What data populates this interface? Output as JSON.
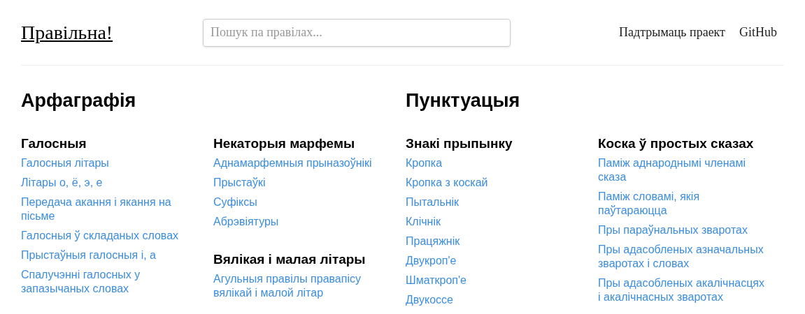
{
  "header": {
    "logo": "Правільна!",
    "search": {
      "placeholder": "Пошук па правілах..."
    },
    "nav": [
      "Падтрымаць праект",
      "GitHub"
    ]
  },
  "sections": [
    {
      "title": "Арфаграфія",
      "columns": [
        [
          {
            "heading": "Галосныя",
            "links": [
              "Галосныя літары",
              "Літары о, ё, э, е",
              "Передача акання і якання на пісьме",
              "Галосныя ў складаных словах",
              "Прыстаўныя галосныя і, а",
              "Спалучэнні галосных у запазычаных словах"
            ]
          }
        ],
        [
          {
            "heading": "Некаторыя марфемы",
            "links": [
              "Аднамарфемныя прыназоўнікі",
              "Прыстаўкі",
              "Суфіксы",
              "Абрэвіятуры"
            ]
          },
          {
            "heading": "Вялікая і малая літары",
            "links": [
              "Агульныя правілы правапісу вялікай і малой літар"
            ]
          }
        ]
      ]
    },
    {
      "title": "Пунктуацыя",
      "columns": [
        [
          {
            "heading": "Знакі прыпынку",
            "links": [
              "Кропка",
              "Кропка з коскай",
              "Пытальнік",
              "Клічнік",
              "Працяжнік",
              "Двукроп'е",
              "Шматкроп'е",
              "Двукоссе"
            ]
          }
        ],
        [
          {
            "heading": "Коска ў простых сказах",
            "links": [
              "Паміж аднароднымі членамі сказа",
              "Паміж словамі, якія паўтараюцца",
              "Пры параўнальных зваротах",
              "Пры адасобленых азначальных зваротах і словах",
              "Пры адасобленых акалічнасцях і акалічнасных зваротах"
            ]
          }
        ]
      ]
    }
  ]
}
